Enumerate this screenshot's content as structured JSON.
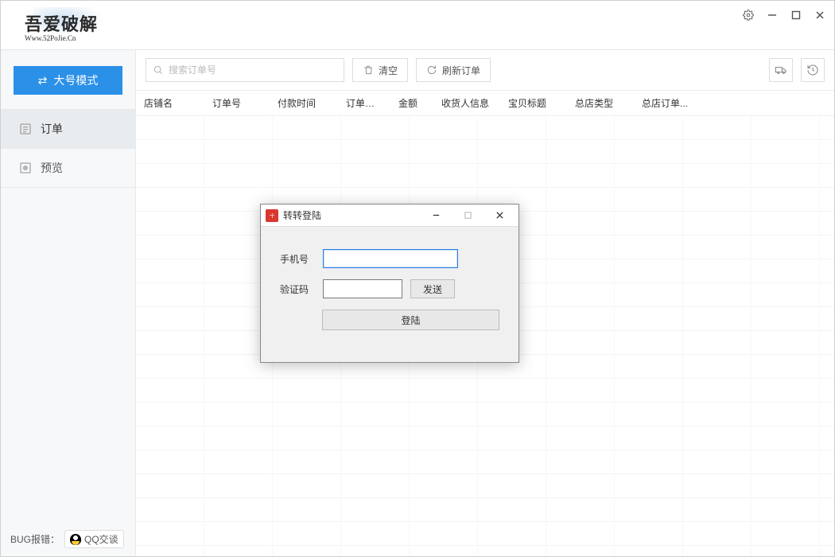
{
  "logo": {
    "main": "吾爱破解",
    "sub": "Www.52PoJie.Cn"
  },
  "sidebar": {
    "mode_button": "大号模式",
    "items": [
      {
        "label": "订单",
        "icon": "list-icon",
        "active": true
      },
      {
        "label": "预览",
        "icon": "preview-icon",
        "active": false
      }
    ],
    "bug_label": "BUG报错：",
    "qq_label": "QQ交谈"
  },
  "toolbar": {
    "search_placeholder": "搜索订单号",
    "clear_label": "清空",
    "refresh_label": "刷新订单"
  },
  "table": {
    "columns": [
      "店铺名",
      "订单号",
      "付款时间",
      "订单状态",
      "金额",
      "收货人信息",
      "宝贝标题",
      "总店类型",
      "总店订单..."
    ]
  },
  "dialog": {
    "title": "转转登陆",
    "phone_label": "手机号",
    "code_label": "验证码",
    "send_label": "发送",
    "login_label": "登陆",
    "phone_value": "",
    "code_value": ""
  }
}
